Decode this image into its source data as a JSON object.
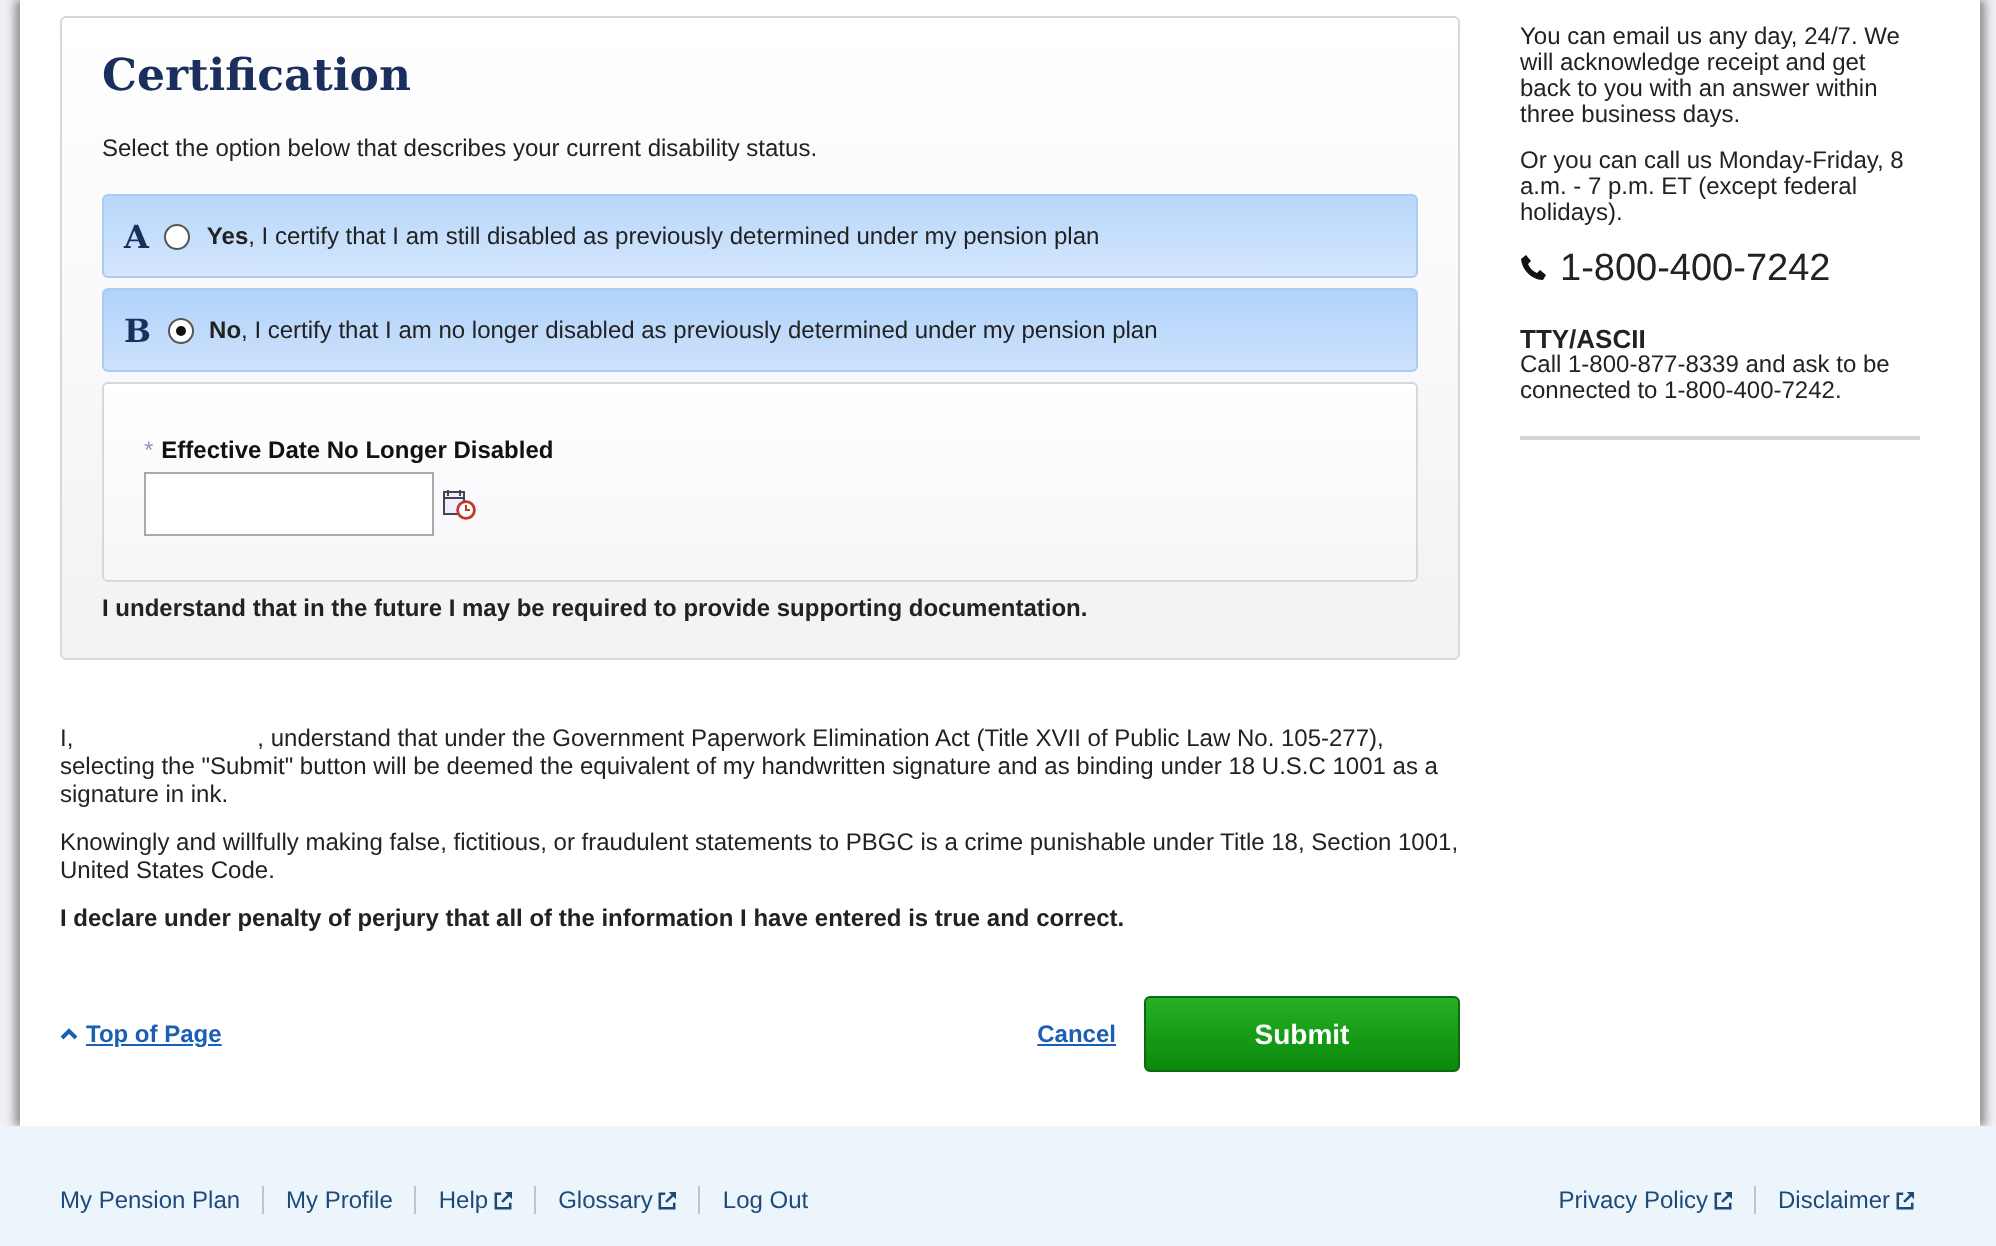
{
  "certification": {
    "title": "Certification",
    "instruction": "Select the option below that describes your current disability status.",
    "options": [
      {
        "letter": "A",
        "text": "**Yes**, I certify that I am still disabled as previously determined under my pension plan",
        "selected": false
      },
      {
        "letter": "B",
        "text": "**No**, I certify that I am no longer disabled as previously determined under my pension plan",
        "selected": true
      }
    ],
    "date_field": {
      "required_mark": "*",
      "label": "Effective Date No Longer Disabled"
    },
    "note": "I understand that in the future I may be required to provide supporting documentation."
  },
  "statements": [
    {
      "kind": "signature",
      "before": "I,",
      "after": ", understand that under the Government Paperwork Elimination Act (Title XVII of Public Law No. 105-277), selecting the \"Submit\" button will be deemed the equivalent of my handwritten signature and as binding under 18 U.S.C 1001 as a signature in ink."
    },
    {
      "kind": "plain",
      "text": "Knowingly and willfully making false, fictitious, or fraudulent statements to PBGC is a crime punishable under Title 18, Section 1001, United States Code."
    },
    {
      "kind": "bold",
      "text": "I declare under penalty of perjury that all of the information I have entered is true and correct."
    }
  ],
  "actions": {
    "top_link": "Top of Page",
    "cancel": "Cancel",
    "submit": "Submit"
  },
  "sidebar": {
    "paragraphs": [
      "You can email us any day, 24/7. We will acknowledge receipt and get back to you with an answer within three business days.",
      "Or you can call us Monday-Friday, 8 a.m. - 7 p.m. ET (except federal holidays)."
    ],
    "phone": "1-800-400-7242",
    "tty_title": "TTY/ASCII",
    "tty_text": "Call 1-800-877-8339 and ask to be connected to 1-800-400-7242."
  },
  "footer": {
    "left": [
      {
        "label": "My Pension Plan",
        "external": false
      },
      {
        "label": "My Profile",
        "external": false
      },
      {
        "label": "Help",
        "external": true
      },
      {
        "label": "Glossary",
        "external": true
      },
      {
        "label": "Log Out",
        "external": false
      }
    ],
    "right": [
      {
        "label": "Privacy Policy",
        "external": true
      },
      {
        "label": "Disclaimer",
        "external": true
      }
    ]
  }
}
